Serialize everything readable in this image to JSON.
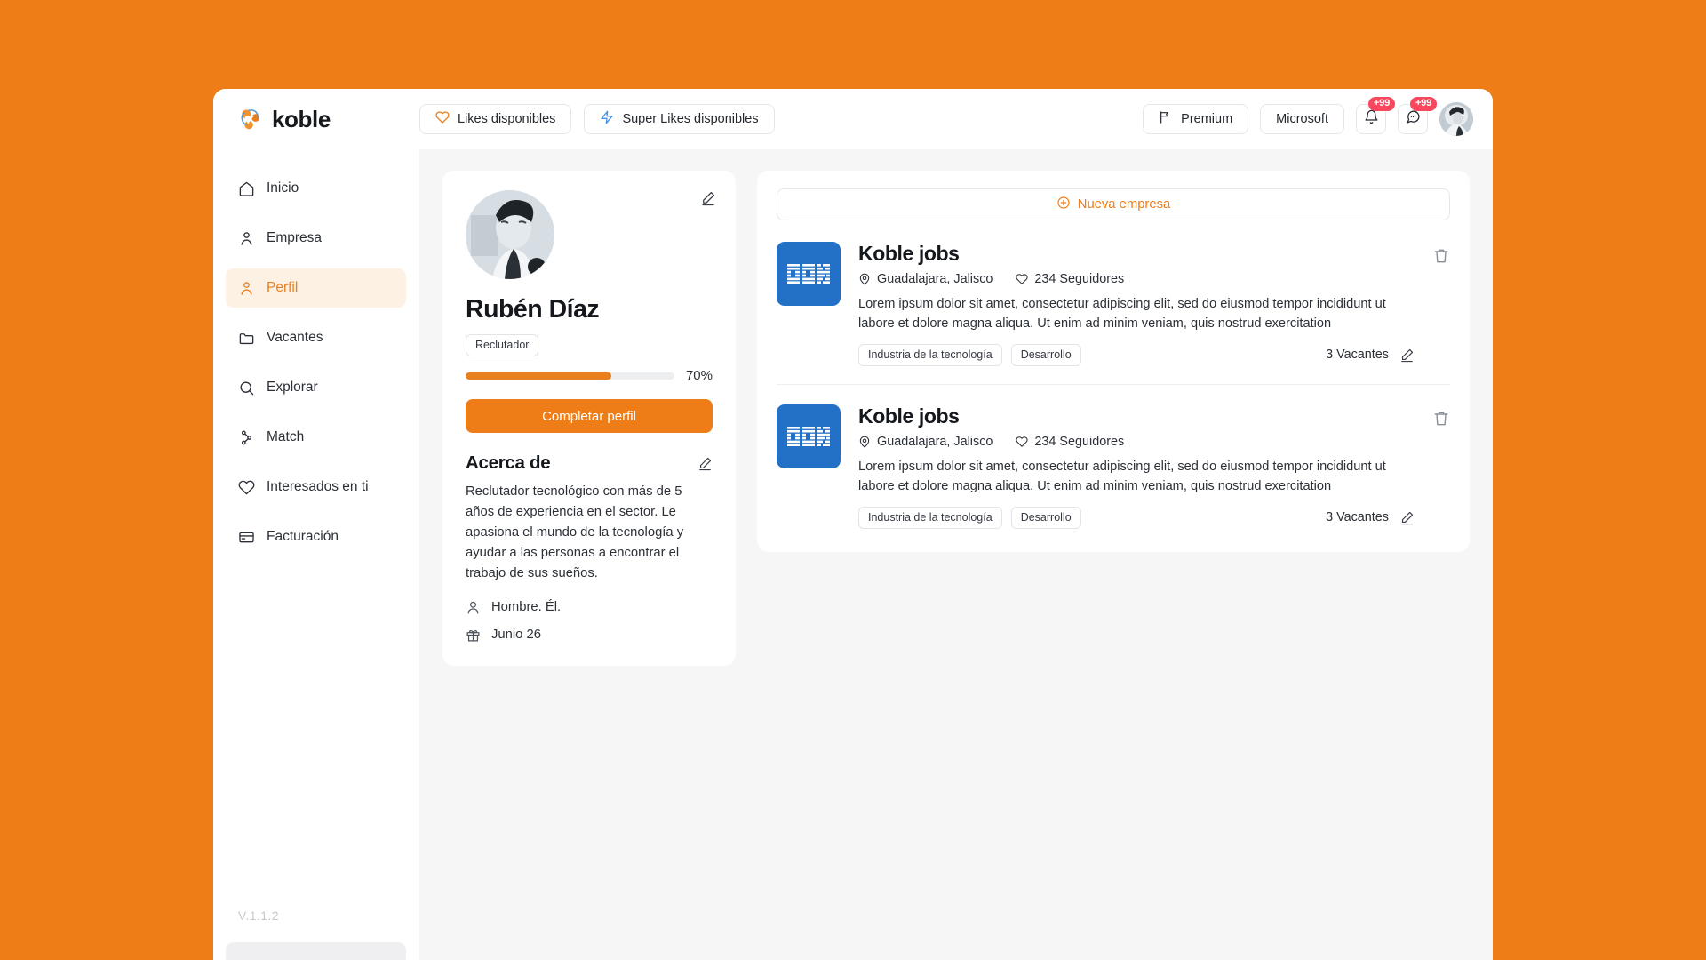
{
  "brand": {
    "name": "koble",
    "logo_icon": "koble-logo-icon"
  },
  "theme": {
    "background": "#EE7D17",
    "accent": "#EE7D17",
    "accent_soft": "#FDF1E4",
    "badge": "#F8485E",
    "ibm_blue": "#2371C6"
  },
  "header": {
    "buttons": [
      {
        "label": "Likes disponibles",
        "icon": "heart-icon"
      },
      {
        "label": "Super Likes disponibles",
        "icon": "lightning-icon"
      }
    ],
    "right_buttons": [
      {
        "label": "Premium",
        "icon": "flag-icon"
      },
      {
        "label": "Microsoft",
        "icon": ""
      }
    ],
    "notifications": {
      "icon": "bell-icon",
      "badge": "+99"
    },
    "messages": {
      "icon": "chat-icon",
      "badge": "+99"
    },
    "avatar": "user-avatar"
  },
  "sidebar": {
    "items": [
      {
        "label": "Inicio",
        "icon": "home-icon",
        "active": false
      },
      {
        "label": "Empresa",
        "icon": "people-icon",
        "active": false
      },
      {
        "label": "Perfil",
        "icon": "people-icon",
        "active": true
      },
      {
        "label": "Vacantes",
        "icon": "folder-icon",
        "active": false
      },
      {
        "label": "Explorar",
        "icon": "search-icon",
        "active": false
      },
      {
        "label": "Match",
        "icon": "match-icon",
        "active": false
      },
      {
        "label": "Interesados en ti",
        "icon": "heart-icon",
        "active": false
      },
      {
        "label": "Facturación",
        "icon": "card-icon",
        "active": false
      }
    ],
    "version": "V.1.1.2"
  },
  "profile": {
    "photo": "profile-photo",
    "name": "Rubén Díaz",
    "role": "Reclutador",
    "progress_percent": 70,
    "progress_label": "70%",
    "cta_label": "Completar perfil",
    "about_title": "Acerca de",
    "about_text": "Reclutador tecnológico con más de 5 años de experiencia en el sector. Le apasiona el mundo de la tecnología y ayudar a las personas a encontrar el trabajo de sus sueños.",
    "gender": "Hombre. Él.",
    "birthday": "Junio 26"
  },
  "companies_panel": {
    "new_company_label": "Nueva empresa",
    "items": [
      {
        "logo_text": "IBM",
        "name": "Koble jobs",
        "location": "Guadalajara, Jalisco",
        "followers": "234 Seguidores",
        "description": "Lorem ipsum dolor sit amet, consectetur adipiscing elit, sed do eiusmod tempor incididunt ut labore et dolore magna aliqua. Ut enim ad minim veniam, quis nostrud exercitation",
        "tags": [
          "Industria de la tecnología",
          "Desarrollo"
        ],
        "vacancies": "3 Vacantes"
      },
      {
        "logo_text": "IBM",
        "name": "Koble jobs",
        "location": "Guadalajara, Jalisco",
        "followers": "234 Seguidores",
        "description": "Lorem ipsum dolor sit amet, consectetur adipiscing elit, sed do eiusmod tempor incididunt ut labore et dolore magna aliqua. Ut enim ad minim veniam, quis nostrud exercitation",
        "tags": [
          "Industria de la tecnología",
          "Desarrollo"
        ],
        "vacancies": "3 Vacantes"
      }
    ]
  }
}
